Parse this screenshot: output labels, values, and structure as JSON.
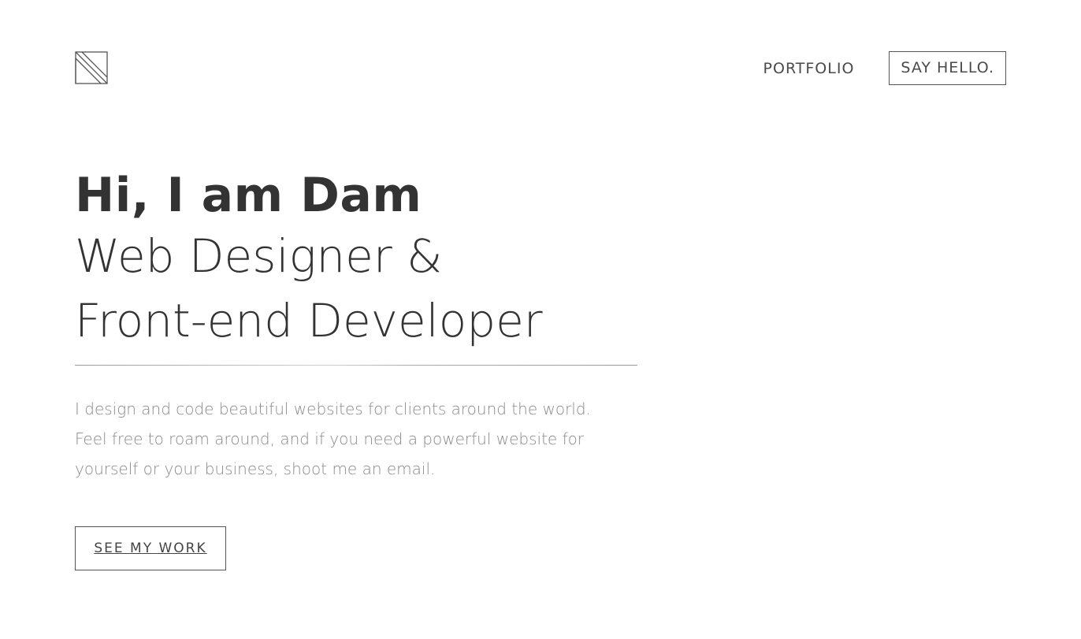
{
  "header": {
    "logo_icon": "logo-icon",
    "nav": {
      "portfolio_label": "PORTFOLIO",
      "say_hello_label": "SAY HELLO."
    }
  },
  "hero": {
    "greeting": "Hi, I am Dam",
    "role_line_1": "Web Designer &",
    "role_line_2": "Front-end Developer",
    "intro_lines": [
      "I design and code beautiful websites for clients around the world.",
      "Feel free to roam around, and if you need a powerful website for",
      "yourself or your business, shoot me an email."
    ],
    "cta_label": "SEE MY WORK"
  },
  "colors": {
    "text_dark": "#333333",
    "text_muted": "#8a8a8a",
    "border": "#555555",
    "background": "#ffffff"
  }
}
